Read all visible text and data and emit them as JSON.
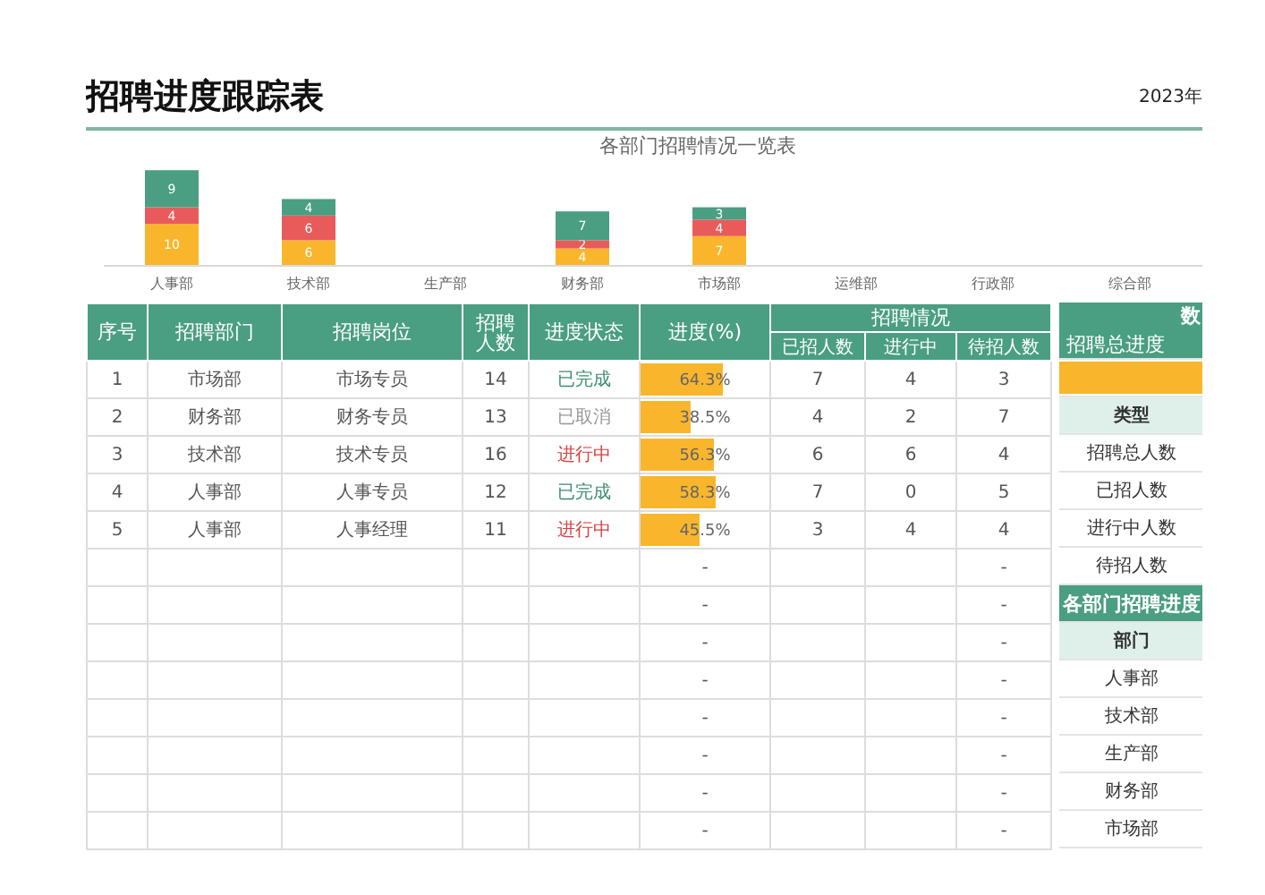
{
  "title": "招聘进度跟踪表",
  "year": "2023年",
  "chart": {
    "chart_data": {
      "type": "bar",
      "title": "各部门招聘情况一览表",
      "stacked": true,
      "data_labels": true,
      "categories": [
        "人事部",
        "技术部",
        "生产部",
        "财务部",
        "市场部",
        "运维部",
        "行政部",
        "综合部"
      ],
      "series": [
        {
          "color": "#f9b62d",
          "values": [
            10,
            6,
            null,
            4,
            7,
            null,
            null,
            null
          ]
        },
        {
          "color": "#e95b5b",
          "values": [
            4,
            6,
            null,
            2,
            4,
            null,
            null,
            null
          ]
        },
        {
          "color": "#4a9e82",
          "values": [
            9,
            4,
            null,
            7,
            3,
            null,
            null,
            null
          ]
        }
      ]
    }
  },
  "table": {
    "columns": [
      "序号",
      "招聘部门",
      "招聘岗位",
      "招聘人数",
      "进度状态",
      "进度(%)"
    ],
    "group_header": "招聘情况",
    "sub_columns": [
      "已招人数",
      "进行中",
      "待招人数"
    ],
    "rows": [
      {
        "no": "1",
        "dept": "市场部",
        "position": "市场专员",
        "count": "14",
        "status": "已完成",
        "kind": "done",
        "level": 0.643,
        "progress": "64.3%",
        "hired": "7",
        "ongoing": "4",
        "pending": "3"
      },
      {
        "no": "2",
        "dept": "财务部",
        "position": "财务专员",
        "count": "13",
        "status": "已取消",
        "kind": "cancelled",
        "level": 0.385,
        "progress": "38.5%",
        "hired": "4",
        "ongoing": "2",
        "pending": "7"
      },
      {
        "no": "3",
        "dept": "技术部",
        "position": "技术专员",
        "count": "16",
        "status": "进行中",
        "kind": "in_progress",
        "level": 0.563,
        "progress": "56.3%",
        "hired": "6",
        "ongoing": "6",
        "pending": "4"
      },
      {
        "no": "4",
        "dept": "人事部",
        "position": "人事专员",
        "count": "12",
        "status": "已完成",
        "kind": "done",
        "level": 0.583,
        "progress": "58.3%",
        "hired": "7",
        "ongoing": "0",
        "pending": "5"
      },
      {
        "no": "5",
        "dept": "人事部",
        "position": "人事经理",
        "count": "11",
        "status": "进行中",
        "kind": "in_progress",
        "level": 0.455,
        "progress": "45.5%",
        "hired": "3",
        "ongoing": "4",
        "pending": "4"
      }
    ],
    "empty_rows": [
      {
        "progress": "-",
        "pending": "-"
      },
      {
        "progress": "-",
        "pending": "-"
      },
      {
        "progress": "-",
        "pending": "-"
      },
      {
        "progress": "-",
        "pending": "-"
      },
      {
        "progress": "-",
        "pending": "-"
      },
      {
        "progress": "-",
        "pending": "-"
      },
      {
        "progress": "-",
        "pending": "-"
      },
      {
        "progress": "-",
        "pending": "-"
      }
    ]
  },
  "side_panel": {
    "header": "数",
    "rows": [
      {
        "kind": "subheader",
        "text": "招聘总进度"
      },
      {
        "kind": "bar",
        "level": 1
      },
      {
        "kind": "label",
        "text": "类型"
      },
      {
        "kind": "item",
        "text": "招聘总人数"
      },
      {
        "kind": "item",
        "text": "已招人数"
      },
      {
        "kind": "item",
        "text": "进行中人数"
      },
      {
        "kind": "item",
        "text": "待招人数"
      },
      {
        "kind": "section",
        "text": "各部门招聘进度"
      },
      {
        "kind": "label",
        "text": "部门"
      },
      {
        "kind": "item",
        "text": "人事部"
      },
      {
        "kind": "item",
        "text": "技术部"
      },
      {
        "kind": "item",
        "text": "生产部"
      },
      {
        "kind": "item",
        "text": "财务部"
      },
      {
        "kind": "item",
        "text": "市场部"
      }
    ]
  }
}
